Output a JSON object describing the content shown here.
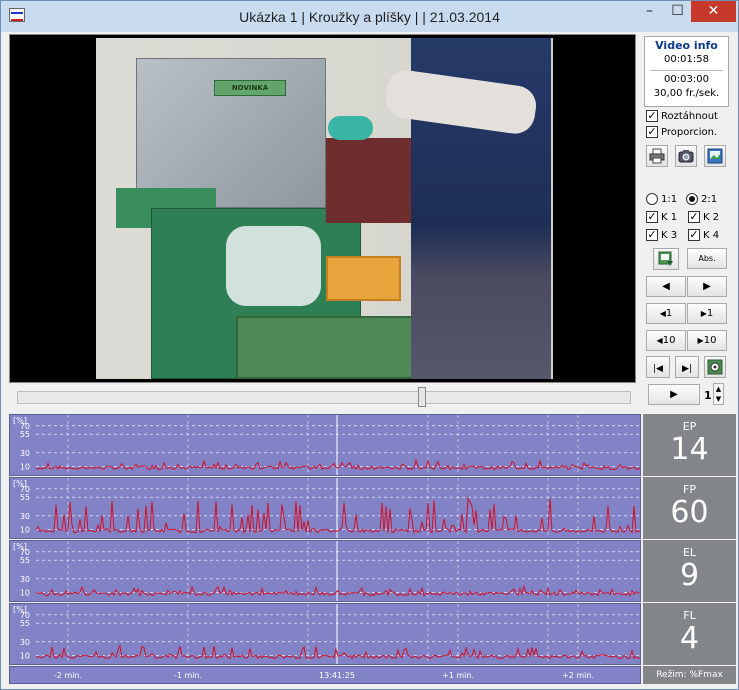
{
  "window": {
    "title": "Ukázka 1 | Kroužky a plíšky |  | 21.03.2014",
    "min_label": "–",
    "max_label": "☐",
    "close_label": "✕"
  },
  "video_info": {
    "title": "Video info",
    "current_time": "00:01:58",
    "duration": "00:03:00",
    "fps": "30,00 fr./sek.",
    "machine_label": "NOVINKA"
  },
  "options": {
    "stretch_label": "Roztáhnout",
    "proportional_label": "Proporcion.",
    "ratio_1_label": "1:1",
    "ratio_2_label": "2:1",
    "ratio_selected": "2:1",
    "channels": [
      {
        "label": "K 1",
        "checked": true
      },
      {
        "label": "K 2",
        "checked": true
      },
      {
        "label": "K 3",
        "checked": true
      },
      {
        "label": "K 4",
        "checked": true
      }
    ]
  },
  "toolbar": {
    "abs_label": "Abs.",
    "step_back_1": "1",
    "step_fwd_1": "1",
    "step_back_10": "10",
    "step_fwd_10": "10",
    "speed_value": "1"
  },
  "scrubber": {
    "position_fraction": 0.66
  },
  "graphs": [
    {
      "name": "EP",
      "value": "14",
      "unit_label": "[%]",
      "y_ticks": [
        "70",
        "55",
        "30",
        "10"
      ]
    },
    {
      "name": "FP",
      "value": "60",
      "unit_label": "[%]",
      "y_ticks": [
        "70",
        "55",
        "30",
        "10"
      ]
    },
    {
      "name": "EL",
      "value": "9",
      "unit_label": "[%]",
      "y_ticks": [
        "70",
        "55",
        "30",
        "10"
      ]
    },
    {
      "name": "FL",
      "value": "4",
      "unit_label": "[%]",
      "y_ticks": [
        "70",
        "55",
        "30",
        "10"
      ]
    }
  ],
  "time_axis": {
    "ticks": [
      "-2 min.",
      "-1 min.",
      "13:41:25",
      "+1 min.",
      "+2 min."
    ],
    "mode_label": "Režim: %Fmax"
  },
  "colors": {
    "graph_bg": "#8283c6",
    "signal": "#d0102a",
    "grid": "#ffffff",
    "value_panel": "#838689"
  }
}
